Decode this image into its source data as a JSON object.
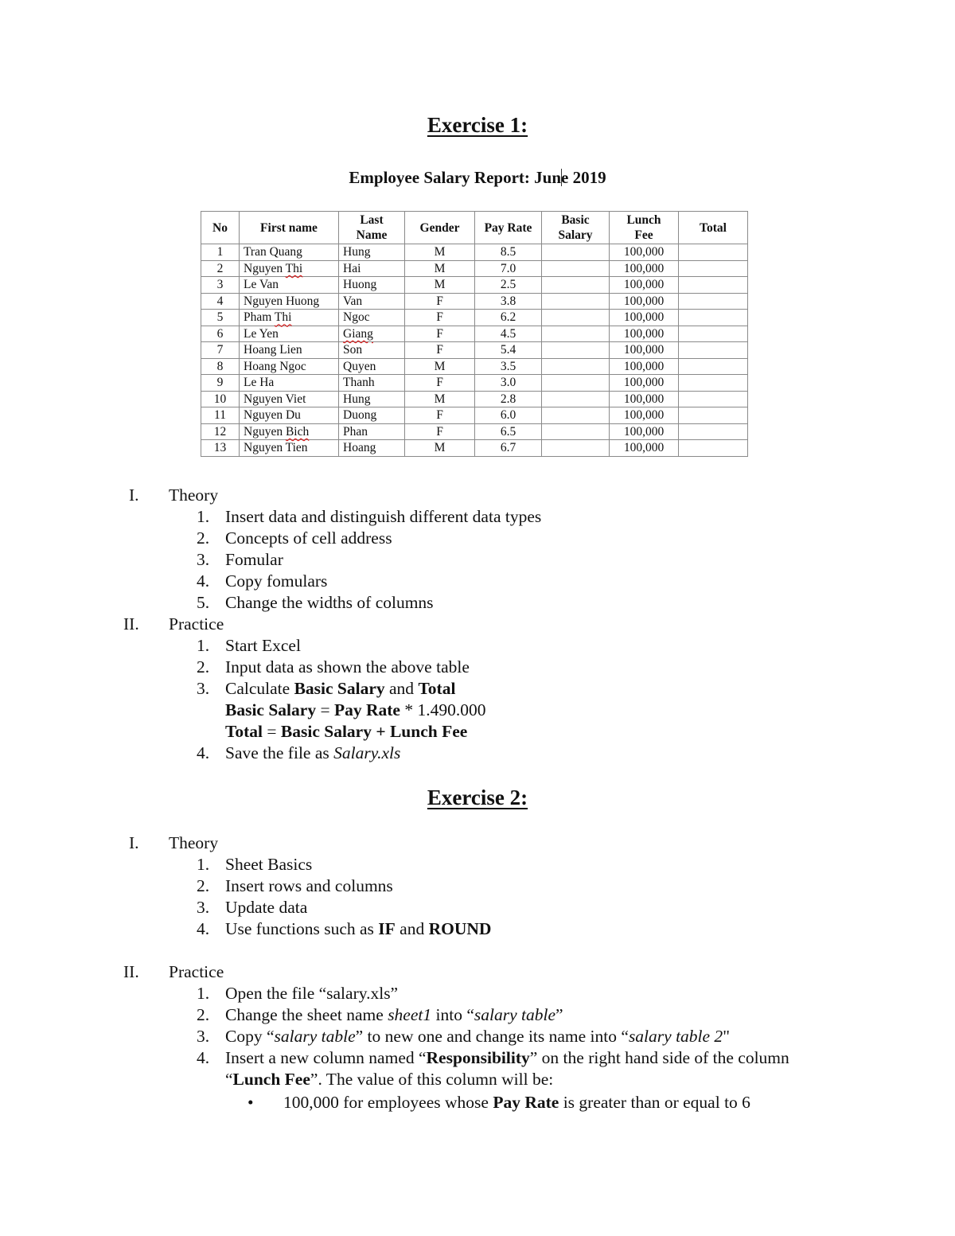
{
  "exercise1": {
    "title": "Exercise 1:",
    "report_title_a": "Employee Salary Report: Jun",
    "report_title_b": "e 2019",
    "table": {
      "headers": {
        "no": "No",
        "first_name": "First name",
        "last_name_1": "Last",
        "last_name_2": "Name",
        "gender": "Gender",
        "pay_rate": "Pay Rate",
        "basic_salary_1": "Basic",
        "basic_salary_2": "Salary",
        "lunch_fee_1": "Lunch",
        "lunch_fee_2": "Fee",
        "total": "Total"
      },
      "rows": [
        {
          "no": "1",
          "first": "Tran Quang",
          "last": "Hung",
          "gender": "M",
          "pay_rate": "8.5",
          "basic": "",
          "lunch": "100,000",
          "total": ""
        },
        {
          "no": "2",
          "first": "Nguyen Thi",
          "last": "Hai",
          "gender": "M",
          "pay_rate": "7.0",
          "basic": "",
          "lunch": "100,000",
          "total": ""
        },
        {
          "no": "3",
          "first": "Le Van",
          "last": "Huong",
          "gender": "M",
          "pay_rate": "2.5",
          "basic": "",
          "lunch": "100,000",
          "total": ""
        },
        {
          "no": "4",
          "first": "Nguyen Huong",
          "last": "Van",
          "gender": "F",
          "pay_rate": "3.8",
          "basic": "",
          "lunch": "100,000",
          "total": ""
        },
        {
          "no": "5",
          "first": "Pham Thi",
          "last": "Ngoc",
          "gender": "F",
          "pay_rate": "6.2",
          "basic": "",
          "lunch": "100,000",
          "total": ""
        },
        {
          "no": "6",
          "first": "Le Yen",
          "last": "Giang",
          "gender": "F",
          "pay_rate": "4.5",
          "basic": "",
          "lunch": "100,000",
          "total": ""
        },
        {
          "no": "7",
          "first": "Hoang Lien",
          "last": "Son",
          "gender": "F",
          "pay_rate": "5.4",
          "basic": "",
          "lunch": "100,000",
          "total": ""
        },
        {
          "no": "8",
          "first": "Hoang Ngoc",
          "last": "Quyen",
          "gender": "M",
          "pay_rate": "3.5",
          "basic": "",
          "lunch": "100,000",
          "total": ""
        },
        {
          "no": "9",
          "first": "Le Ha",
          "last": "Thanh",
          "gender": "F",
          "pay_rate": "3.0",
          "basic": "",
          "lunch": "100,000",
          "total": ""
        },
        {
          "no": "10",
          "first": "Nguyen Viet",
          "last": "Hung",
          "gender": "M",
          "pay_rate": "2.8",
          "basic": "",
          "lunch": "100,000",
          "total": ""
        },
        {
          "no": "11",
          "first": "Nguyen Du",
          "last": "Duong",
          "gender": "F",
          "pay_rate": "6.0",
          "basic": "",
          "lunch": "100,000",
          "total": ""
        },
        {
          "no": "12",
          "first": "Nguyen Bich",
          "last": "Phan",
          "gender": "F",
          "pay_rate": "6.5",
          "basic": "",
          "lunch": "100,000",
          "total": ""
        },
        {
          "no": "13",
          "first": "Nguyen Tien",
          "last": "Hoang",
          "gender": "M",
          "pay_rate": "6.7",
          "basic": "",
          "lunch": "100,000",
          "total": ""
        }
      ]
    },
    "theory": {
      "numeral": "I.",
      "heading": "Theory",
      "items": [
        {
          "n": "1.",
          "text": "Insert data and distinguish different data types"
        },
        {
          "n": "2.",
          "text": "Concepts of cell address"
        },
        {
          "n": "3.",
          "text": "Fomular"
        },
        {
          "n": "4.",
          "text": "Copy fomulars"
        },
        {
          "n": "5.",
          "text": "Change the widths of columns"
        }
      ]
    },
    "practice": {
      "numeral": "II.",
      "heading": "Practice",
      "item1": {
        "n": "1.",
        "text": "Start Excel"
      },
      "item2": {
        "n": "2.",
        "text": "Input data as shown the above table"
      },
      "item3": {
        "n": "3.",
        "pre": "Calculate ",
        "b1": "Basic Salary",
        "mid": " and ",
        "b2": "Total",
        "formula1_b1": "Basic Salary",
        "formula1_eq": " = ",
        "formula1_b2": "Pay Rate",
        "formula1_op": " * ",
        "formula1_val": "1.490.000",
        "formula2_b1": "Total",
        "formula2_eq": " = ",
        "formula2_b2": "Basic Salary + Lunch Fee"
      },
      "item4": {
        "n": "4.",
        "pre": "Save the file as ",
        "file": "Salary.xls"
      }
    }
  },
  "exercise2": {
    "title": "Exercise 2:",
    "theory": {
      "numeral": "I.",
      "heading": "Theory",
      "item1": {
        "n": "1.",
        "text": "Sheet Basics"
      },
      "item2": {
        "n": "2.",
        "text": "Insert rows and columns"
      },
      "item3": {
        "n": "3.",
        "text": "Update data"
      },
      "item4": {
        "n": "4.",
        "pre": "Use functions such as ",
        "b1": "IF",
        "mid": " and ",
        "b2": "ROUND"
      }
    },
    "practice": {
      "numeral": "II.",
      "heading": "Practice",
      "item1": {
        "n": "1.",
        "text": "Open the file “salary.xls”"
      },
      "item2": {
        "n": "2.",
        "pre": "Change the sheet name ",
        "i1": "sheet1",
        "mid": " into “",
        "i2": "salary table",
        "post": "”"
      },
      "item3": {
        "n": "3.",
        "pre": "Copy “",
        "i1": "salary table",
        "mid": "” to new one and change its name into “",
        "i2": "salary table 2",
        "post": "\""
      },
      "item4": {
        "n": "4.",
        "pre": "Insert a new column named “",
        "b1": "Responsibility",
        "mid": "” on the right hand side of the column",
        "line2_pre": "“",
        "b2": "Lunch Fee",
        "line2_post": "”. The value of this column will be:"
      },
      "bullet": {
        "symbol": "•",
        "pre": "100,000 for employees whose ",
        "b": "Pay Rate",
        "post": " is greater than or equal to 6"
      }
    }
  }
}
